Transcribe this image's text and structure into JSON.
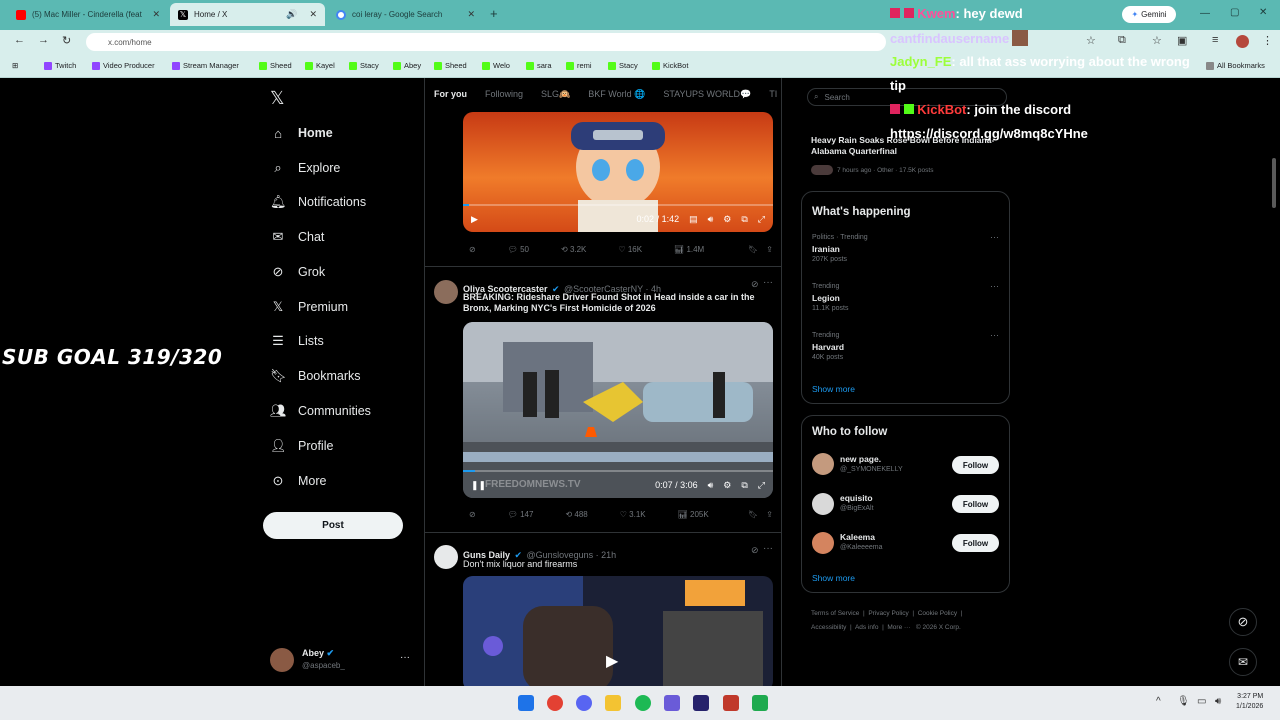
{
  "browser": {
    "tabs": [
      {
        "label": "(5) Mac Miller - Cinderella (feat",
        "active": false
      },
      {
        "label": "Home / X",
        "active": true
      },
      {
        "label": "coi leray - Google Search",
        "active": false
      }
    ],
    "gemini_label": "Gemini",
    "address": "x.com/home",
    "bookmarks": [
      "Twitch",
      "Video Producer",
      "Stream Manager",
      "Sheed",
      "Kayel",
      "Stacy",
      "Abey",
      "Sheed",
      "Welo",
      "sara",
      "remi",
      "Stacy",
      "KickBot"
    ],
    "all_bookmarks": "All Bookmarks"
  },
  "sidebar": {
    "items": [
      {
        "label": "Home",
        "icon": "home-icon",
        "active": true
      },
      {
        "label": "Explore",
        "icon": "search-icon"
      },
      {
        "label": "Notifications",
        "icon": "bell-icon"
      },
      {
        "label": "Chat",
        "icon": "mail-icon"
      },
      {
        "label": "Grok",
        "icon": "grok-icon"
      },
      {
        "label": "Premium",
        "icon": "x-icon"
      },
      {
        "label": "Lists",
        "icon": "list-icon"
      },
      {
        "label": "Bookmarks",
        "icon": "bookmark-icon"
      },
      {
        "label": "Communities",
        "icon": "people-icon"
      },
      {
        "label": "Profile",
        "icon": "person-icon"
      },
      {
        "label": "More",
        "icon": "more-circle-icon"
      }
    ],
    "post_label": "Post",
    "account": {
      "name": "Abey",
      "handle": "@aspaceb_"
    }
  },
  "feed": {
    "tabs": [
      "For you",
      "Following",
      "SLG🙉",
      "BKF World 🌐",
      "STAYUPS WORLD💬",
      "TI"
    ],
    "video1": {
      "time": "0:02 / 1:42",
      "replies": "50",
      "reposts": "3.2K",
      "likes": "16K",
      "views": "1.4M",
      "progress": 0.02
    },
    "tweet2": {
      "name": "Oliya Scootercaster",
      "handle": "@ScooterCasterNY · 4h",
      "text": "BREAKING: Rideshare Driver Found Shot in Head inside a car in the Bronx, Marking NYC's First Homicide of 2026",
      "watermark": "FREEDOMNEWS.TV",
      "time": "0:07 / 3:06",
      "replies": "147",
      "reposts": "488",
      "likes": "3.1K",
      "views": "205K",
      "progress": 0.04
    },
    "tweet3": {
      "name": "Guns Daily",
      "handle": "@Gunsloveguns · 21h",
      "text": "Don't mix liquor and firearms"
    }
  },
  "right": {
    "search_placeholder": "Search",
    "news": {
      "title": "Heavy Rain Soaks Rose Bowl Before Indiana-Alabama Quarterfinal",
      "meta": "7 hours ago · Other · 17.5K posts"
    },
    "happening_title": "What's happening",
    "trends": [
      {
        "category": "Politics · Trending",
        "name": "Iranian",
        "posts": "207K posts"
      },
      {
        "category": "Trending",
        "name": "Legion",
        "posts": "11.1K posts"
      },
      {
        "category": "Trending",
        "name": "Harvard",
        "posts": "40K posts"
      }
    ],
    "show_more": "Show more",
    "who_title": "Who to follow",
    "follow": [
      {
        "name": "new page.",
        "handle": "@_SYMONEKELLY"
      },
      {
        "name": "equisito",
        "handle": "@BigExAlt"
      },
      {
        "name": "Kaleema",
        "handle": "@Kaleeeema"
      }
    ],
    "follow_label": "Follow",
    "footer": [
      "Terms of Service",
      "Privacy Policy",
      "Cookie Policy",
      "Accessibility",
      "Ads info",
      "More ···",
      "© 2026 X Corp."
    ]
  },
  "overlay": {
    "subgoal": "SUB GOAL 319/320",
    "chat": [
      {
        "user": "Kwem",
        "text": ": hey dewd"
      },
      {
        "user": "cantfindausername",
        "text": ""
      },
      {
        "user": "Jadyn_FE",
        "text": ": all that ass worrying about the wrong"
      },
      {
        "user": "",
        "text": "tip"
      },
      {
        "user": "KickBot",
        "text": ": join the discord"
      },
      {
        "user": "",
        "text": "https://discord.gg/w8mq8cYHne"
      }
    ]
  },
  "taskbar": {
    "time": "3:27 PM",
    "date": "1/1/2026"
  },
  "colors": {
    "accent": "#1d9bf0",
    "tabbar": "#5bb9b3"
  }
}
